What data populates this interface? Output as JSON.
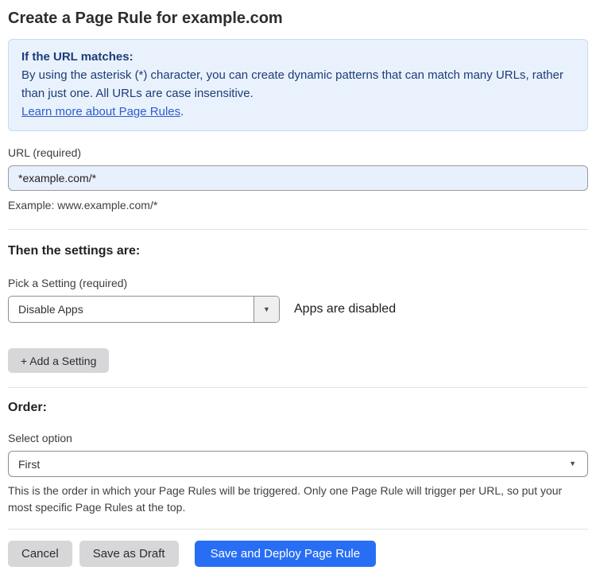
{
  "page": {
    "title": "Create a Page Rule for example.com"
  },
  "info_box": {
    "heading": "If the URL matches:",
    "body": "By using the asterisk (*) character, you can create dynamic patterns that can match many URLs, rather than just one. All URLs are case insensitive.",
    "link_label": "Learn more about Page Rules",
    "link_suffix": "."
  },
  "url_section": {
    "label": "URL (required)",
    "value": "*example.com/*",
    "example": "Example: www.example.com/*"
  },
  "settings_section": {
    "heading": "Then the settings are:",
    "picker_label": "Pick a Setting (required)",
    "selected_setting": "Disable Apps",
    "status_text": "Apps are disabled",
    "add_button_label": "+ Add a Setting"
  },
  "order_section": {
    "heading": "Order:",
    "label": "Select option",
    "selected_option": "First",
    "help_text": "This is the order in which your Page Rules will be triggered. Only one Page Rule will trigger per URL, so put your most specific Page Rules at the top."
  },
  "footer": {
    "cancel_label": "Cancel",
    "save_draft_label": "Save as Draft",
    "deploy_label": "Save and Deploy Page Rule"
  },
  "icons": {
    "chevron_down": "▼"
  },
  "colors": {
    "accent_blue": "#286ef5",
    "info_box_bg": "#e9f2fc",
    "info_box_border": "#c3dbf3",
    "info_box_text": "#1e3c78",
    "link_blue": "#2f5bd1",
    "input_fill": "#e8f0fe",
    "button_gray": "#d7d7d9"
  }
}
